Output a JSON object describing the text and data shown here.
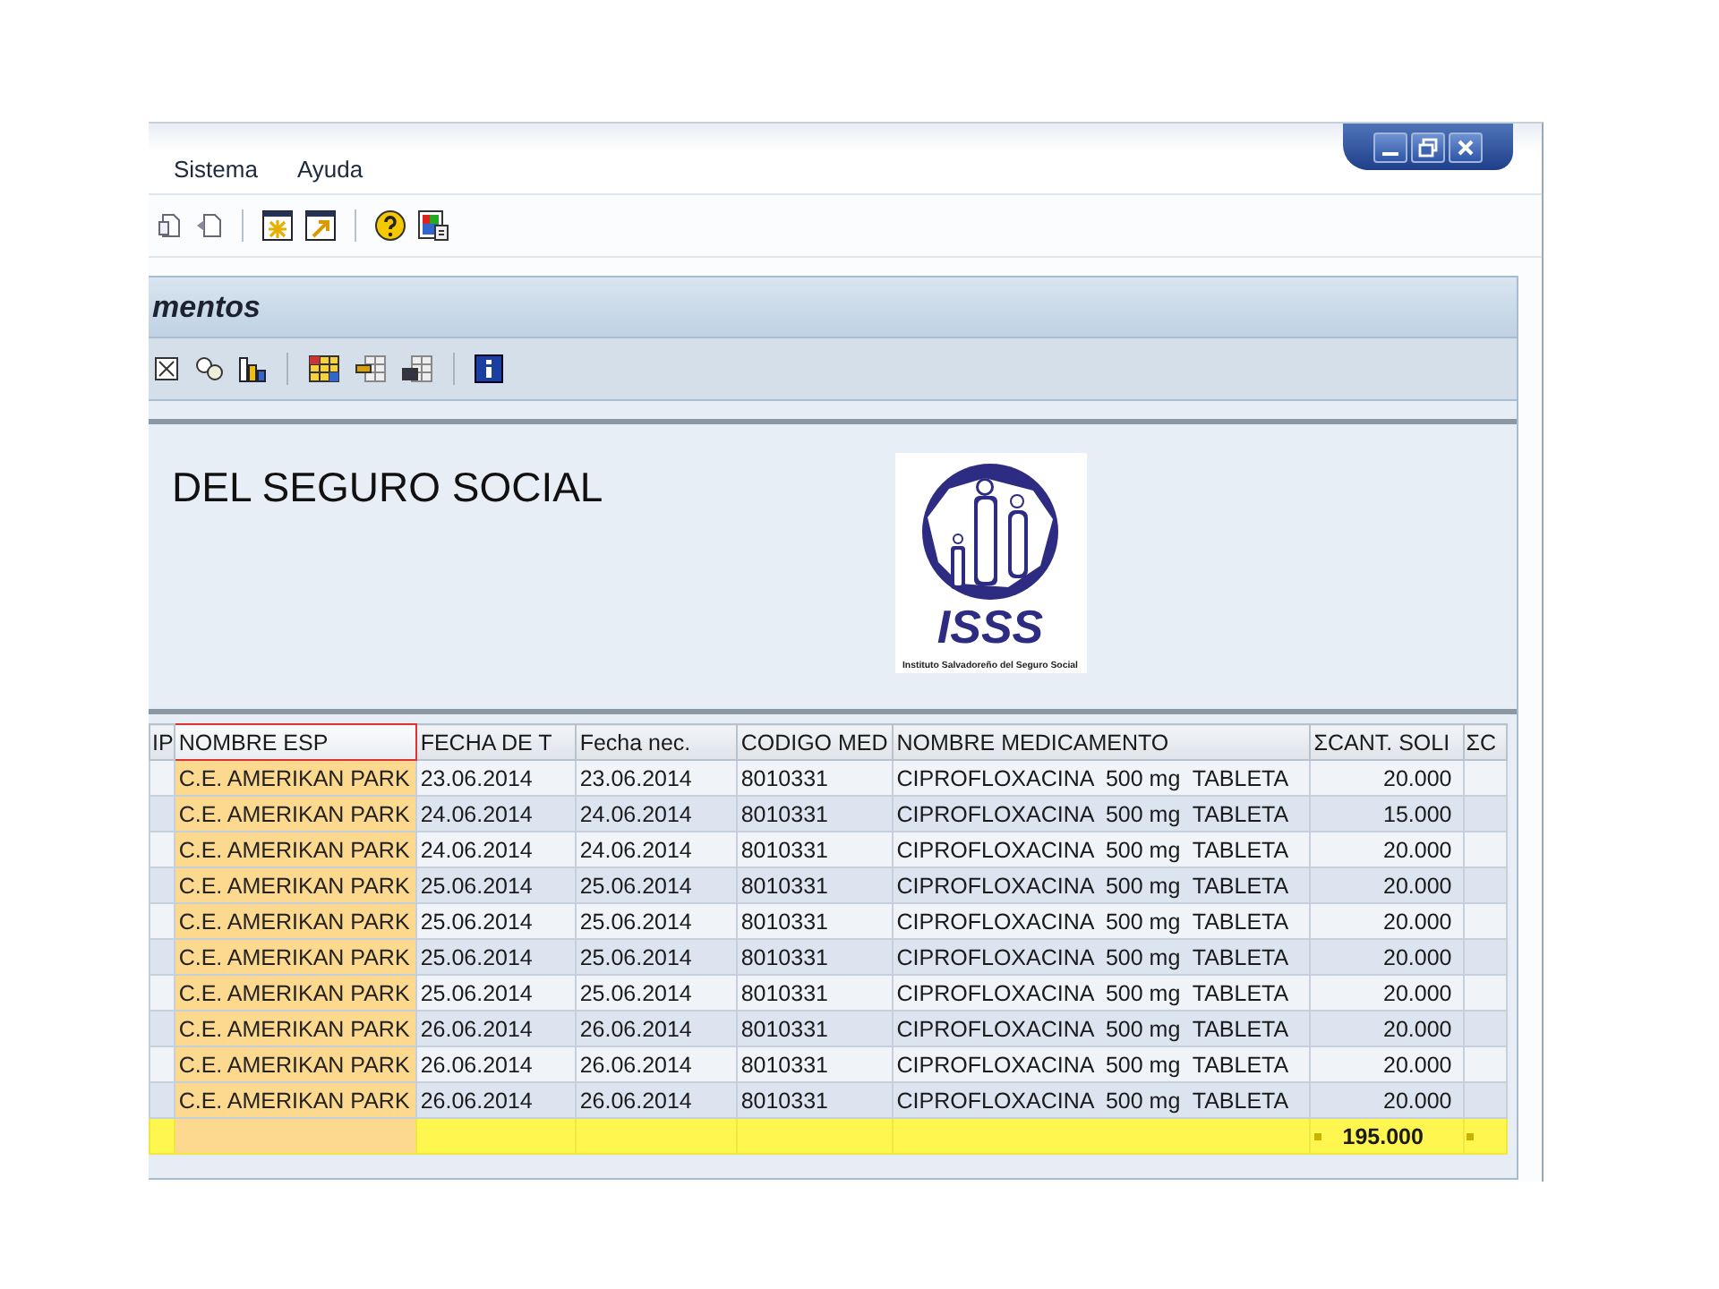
{
  "menu": [
    {
      "label": "Sistema"
    },
    {
      "label": "Ayuda"
    }
  ],
  "panel": {
    "title": "mentos"
  },
  "report_header": {
    "heading": "DEL SEGURO SOCIAL",
    "logo": {
      "letters": "ISSS",
      "caption": "Instituto Salvadoreño del Seguro Social"
    }
  },
  "table": {
    "columns": [
      {
        "label": "IP",
        "kind": "edge",
        "selected": false
      },
      {
        "label": "NOMBRE ESP",
        "kind": "key",
        "selected": true
      },
      {
        "label": "FECHA DE T",
        "kind": "text",
        "selected": false
      },
      {
        "label": "Fecha nec.",
        "kind": "text",
        "selected": false
      },
      {
        "label": "CODIGO MED",
        "kind": "text",
        "selected": false
      },
      {
        "label": "NOMBRE MEDICAMENTO",
        "kind": "text",
        "selected": false
      },
      {
        "label": "ΣCANT. SOLI",
        "kind": "number",
        "selected": false
      },
      {
        "label": "ΣC",
        "kind": "edge",
        "selected": false
      }
    ],
    "rows": [
      [
        "",
        "C.E. AMERIKAN PARK",
        "23.06.2014",
        "23.06.2014",
        "8010331",
        "CIPROFLOXACINA  500 mg  TABLETA",
        "20.000",
        ""
      ],
      [
        "",
        "C.E. AMERIKAN PARK",
        "24.06.2014",
        "24.06.2014",
        "8010331",
        "CIPROFLOXACINA  500 mg  TABLETA",
        "15.000",
        ""
      ],
      [
        "",
        "C.E. AMERIKAN PARK",
        "24.06.2014",
        "24.06.2014",
        "8010331",
        "CIPROFLOXACINA  500 mg  TABLETA",
        "20.000",
        ""
      ],
      [
        "",
        "C.E. AMERIKAN PARK",
        "25.06.2014",
        "25.06.2014",
        "8010331",
        "CIPROFLOXACINA  500 mg  TABLETA",
        "20.000",
        ""
      ],
      [
        "",
        "C.E. AMERIKAN PARK",
        "25.06.2014",
        "25.06.2014",
        "8010331",
        "CIPROFLOXACINA  500 mg  TABLETA",
        "20.000",
        ""
      ],
      [
        "",
        "C.E. AMERIKAN PARK",
        "25.06.2014",
        "25.06.2014",
        "8010331",
        "CIPROFLOXACINA  500 mg  TABLETA",
        "20.000",
        ""
      ],
      [
        "",
        "C.E. AMERIKAN PARK",
        "25.06.2014",
        "25.06.2014",
        "8010331",
        "CIPROFLOXACINA  500 mg  TABLETA",
        "20.000",
        ""
      ],
      [
        "",
        "C.E. AMERIKAN PARK",
        "26.06.2014",
        "26.06.2014",
        "8010331",
        "CIPROFLOXACINA  500 mg  TABLETA",
        "20.000",
        ""
      ],
      [
        "",
        "C.E. AMERIKAN PARK",
        "26.06.2014",
        "26.06.2014",
        "8010331",
        "CIPROFLOXACINA  500 mg  TABLETA",
        "20.000",
        ""
      ],
      [
        "",
        "C.E. AMERIKAN PARK",
        "26.06.2014",
        "26.06.2014",
        "8010331",
        "CIPROFLOXACINA  500 mg  TABLETA",
        "20.000",
        ""
      ]
    ],
    "total": "195.000"
  }
}
